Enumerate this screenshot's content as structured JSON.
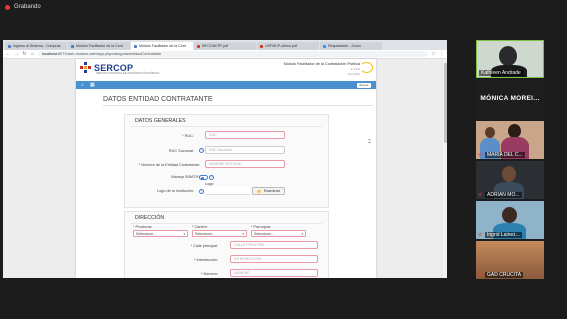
{
  "recording": {
    "label": "Grabando"
  },
  "browser": {
    "tabs": [
      {
        "label": "Ingreso al Sistema - Compras",
        "active": false
      },
      {
        "label": "Módulo Facilitador de la Cont",
        "active": false
      },
      {
        "label": "Módulo Facilitador de la Cont",
        "active": true
      },
      {
        "label": "MFCONCPF.pdf",
        "active": false
      },
      {
        "label": "USFMCP-ultimo.pdf",
        "active": false
      },
      {
        "label": "Respaldante - Zoom",
        "active": false
      }
    ],
    "address_host": "localhost",
    "address_path": ":8071/web-modulo-web/app.php/categoria/entidadContratante"
  },
  "site": {
    "logo_text": "SERCOP",
    "logo_sub": "SERVICIO NACIONAL DE CONTRATACIÓN PÚBLICA",
    "module_title": "Módulo Facilitador de la Contratación Pública",
    "version": "V 1.0.0",
    "version_date": "Jun 2021",
    "search_label": "Buscar"
  },
  "form": {
    "page_title": "DATOS ENTIDAD CONTRATANTE",
    "general": {
      "title": "DATOS GENERALES",
      "ruc_label": "* RUC:",
      "ruc_placeholder": "RUC",
      "sucursal_label": "RUC Sucursal:",
      "sucursal_placeholder": "RUC Sucursal",
      "nombre_label": "* Nombre de la Entidad Contratante:",
      "nombre_placeholder": "NOMBRE ENTIDAD",
      "sibatif_label": "Maneja SIBATIF:",
      "logo_header": "Logo",
      "logo_label": "Logo de la Institución:",
      "examinar_label": "Examinar"
    },
    "direccion": {
      "title": "DIRECCIÓN",
      "provincia_label": "* Provincia:",
      "provincia_value": "Seleccione...",
      "canton_label": "* Cantón:",
      "canton_value": "Seleccione...",
      "parroquia_label": "* Parroquia:",
      "parroquia_value": "Seleccione...",
      "calle_label": "* Calle principal:",
      "calle_placeholder": "CALLE PRINCIPAL",
      "interseccion_label": "* Intersección:",
      "interseccion_placeholder": "INTERSECCIÓN",
      "numero_label": "* Número:",
      "numero_placeholder": "NÚMERO"
    }
  },
  "participants": [
    {
      "name": "Kathleen Andrade",
      "muted": false,
      "active": true
    },
    {
      "name": "MÓNICA MOREI...",
      "muted": false,
      "active": false
    },
    {
      "name": "MARIA DEL C...",
      "muted": true,
      "active": false
    },
    {
      "name": "ADRIAN MO...",
      "muted": true,
      "active": false
    },
    {
      "name": "Ingrid Lainez...",
      "muted": true,
      "active": false
    },
    {
      "name": "GAD CRUCITA",
      "muted": true,
      "active": false
    }
  ]
}
